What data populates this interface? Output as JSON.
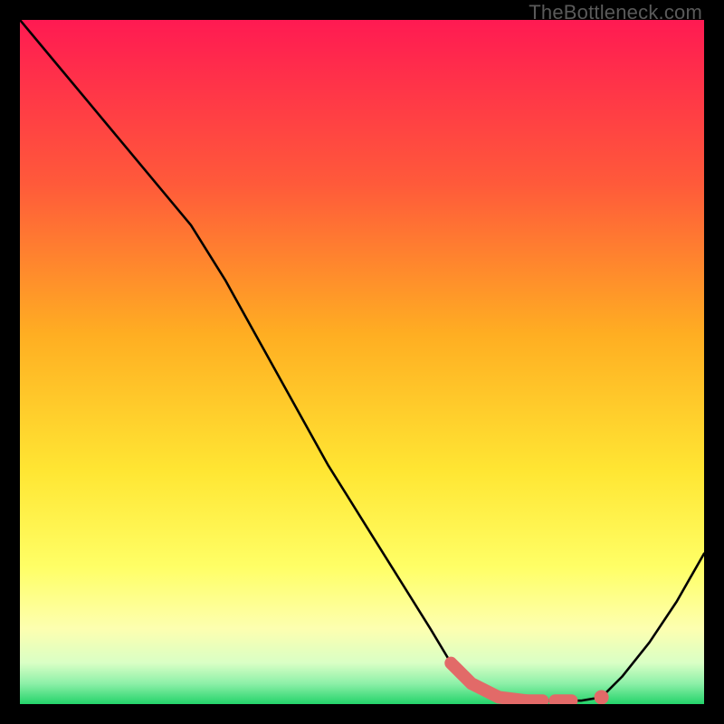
{
  "watermark": "TheBottleneck.com",
  "chart_data": {
    "type": "line",
    "title": "",
    "xlabel": "",
    "ylabel": "",
    "xlim": [
      0,
      100
    ],
    "ylim": [
      0,
      100
    ],
    "grid": false,
    "legend": false,
    "series": [
      {
        "name": "curve",
        "x": [
          0,
          5,
          10,
          15,
          20,
          25,
          30,
          35,
          40,
          45,
          50,
          55,
          60,
          63,
          66,
          70,
          74,
          78,
          82,
          85,
          88,
          92,
          96,
          100
        ],
        "y": [
          100,
          94,
          88,
          82,
          76,
          70,
          62,
          53,
          44,
          35,
          27,
          19,
          11,
          6,
          3,
          1,
          0.5,
          0.5,
          0.5,
          1,
          4,
          9,
          15,
          22
        ]
      }
    ],
    "highlight_segment": {
      "comment": "thick salmon dashed segment near valley",
      "x": [
        63,
        66,
        70,
        74,
        78,
        82
      ],
      "y": [
        6,
        3,
        1,
        0.5,
        0.5,
        0.5
      ]
    },
    "gradient_stops_pct_from_top": [
      {
        "pct": 0,
        "color": "#ff1a52"
      },
      {
        "pct": 24,
        "color": "#ff5a3a"
      },
      {
        "pct": 46,
        "color": "#ffae22"
      },
      {
        "pct": 66,
        "color": "#ffe633"
      },
      {
        "pct": 80,
        "color": "#ffff66"
      },
      {
        "pct": 89,
        "color": "#fdffb0"
      },
      {
        "pct": 94,
        "color": "#d9ffc5"
      },
      {
        "pct": 97,
        "color": "#8df0a8"
      },
      {
        "pct": 100,
        "color": "#24d36a"
      }
    ]
  }
}
